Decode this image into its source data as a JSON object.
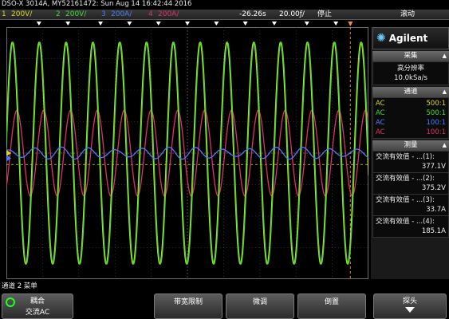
{
  "title_bar": "DSO-X 3014A, MY52161472: Sun Aug 14 16:42:44 2016",
  "status": {
    "ch1": {
      "num": "1",
      "scale": "200V/",
      "color": "#d8d81e"
    },
    "ch2": {
      "num": "2",
      "scale": "200V/",
      "color": "#3cdc3c"
    },
    "ch3": {
      "num": "3",
      "scale": "200A/",
      "color": "#4a7cff"
    },
    "ch4": {
      "num": "4",
      "scale": "200A/",
      "color": "#e0306a"
    },
    "delay": "-26.26s",
    "timebase": "20.00ƒ/",
    "run_state": "停止",
    "trigger_mode": "滚动"
  },
  "brand": {
    "logo_text": "Agilent"
  },
  "acquisition": {
    "header": "采集",
    "mode": "高分辨率",
    "rate": "10.0kSa/s"
  },
  "channels_panel": {
    "header": "通道",
    "rows": [
      {
        "coupling": "AC",
        "ratio": "500:1",
        "color": "#d8d81e"
      },
      {
        "coupling": "AC",
        "ratio": "500:1",
        "color": "#3cdc3c"
      },
      {
        "coupling": "AC",
        "ratio": "100:1",
        "color": "#4a7cff"
      },
      {
        "coupling": "AC",
        "ratio": "100:1",
        "color": "#e0306a"
      }
    ]
  },
  "measurements": {
    "header": "测量",
    "items": [
      {
        "label": "交流有效值 - ...(1):",
        "value": "377.1V"
      },
      {
        "label": "交流有效值 - ...(2):",
        "value": "375.2V"
      },
      {
        "label": "交流有效值 - ...(3):",
        "value": "33.7A"
      },
      {
        "label": "交流有效值 - ...(4):",
        "value": "185.1A"
      }
    ]
  },
  "bottom_label": "通道 2 菜单",
  "softkeys": {
    "coupling_title": "耦合",
    "coupling_value": "交流AC",
    "bw_limit": "带宽限制",
    "fine": "微调",
    "invert": "倒置",
    "probe": "探头"
  },
  "traces": {
    "ch1": {
      "cycles": 13.5,
      "amplitude": 0.44,
      "offset": 0.5
    },
    "ch2": {
      "cycles": 13.5,
      "amplitude": 0.44,
      "offset": 0.5
    },
    "ch3": {
      "cycles": 13.5,
      "amplitude": 0.02,
      "offset": 0.5
    },
    "ch4": {
      "cycles": 13.5,
      "amplitude": 0.17,
      "offset": 0.5
    }
  }
}
